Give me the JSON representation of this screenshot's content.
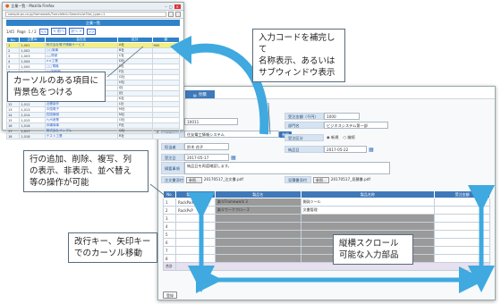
{
  "colors": {
    "accent": "#2f82c8",
    "arrow": "#3fa9e0",
    "highlight": "#f4f07a"
  },
  "popup": {
    "title": "企業一覧 - Mozilla Firefox",
    "url": "sample.ps.co.jp/framework/?servletid=SearchList?list_type=1",
    "header": "企業一覧",
    "pager": {
      "count": "1/45",
      "page_label": "Page",
      "page": "1 / 2",
      "prev": "< 前へ",
      "next": "次へ >",
      "first": "<<",
      "last": ">>"
    },
    "columns": [
      "No.",
      "企業ID",
      "会社名",
      "区分",
      "値"
    ],
    "rows": [
      {
        "no": "1",
        "id": "1,001",
        "name": "株式会社電子情報サービス",
        "kbn": "A社",
        "val": "900"
      },
      {
        "no": "2",
        "id": "1,002",
        "name": "○○商事",
        "kbn": "B社",
        "val": ""
      },
      {
        "no": "3",
        "id": "1,003",
        "name": "△△物産",
        "kbn": "C社",
        "val": ""
      },
      {
        "no": "4",
        "id": "1,004",
        "name": "××工業",
        "kbn": "D社",
        "val": ""
      },
      {
        "no": "5",
        "id": "1,005",
        "name": "□□電機",
        "kbn": "E社",
        "val": ""
      },
      {
        "no": "6",
        "id": "1,006",
        "name": "◇◇製作所",
        "kbn": "F社",
        "val": ""
      },
      {
        "no": "7",
        "id": "1,007",
        "name": "☆☆システム",
        "kbn": "G社",
        "val": ""
      },
      {
        "no": "8",
        "id": "1,008",
        "name": "北海道物流",
        "kbn": "H社",
        "val": ""
      },
      {
        "no": "9",
        "id": "1,009",
        "name": "東北開発",
        "kbn": "I社",
        "val": ""
      },
      {
        "no": "10",
        "id": "1,010",
        "name": "関東商会",
        "kbn": "J社",
        "val": ""
      },
      {
        "no": "11",
        "id": "1,011",
        "name": "中部工業",
        "kbn": "K社",
        "val": ""
      },
      {
        "no": "12",
        "id": "1,012",
        "name": "近畿製作",
        "kbn": "L社",
        "val": ""
      },
      {
        "no": "13",
        "id": "1,013",
        "name": "中国電子",
        "kbn": "M社",
        "val": ""
      },
      {
        "no": "14",
        "id": "1,014",
        "name": "四国機械",
        "kbn": "N社",
        "val": ""
      },
      {
        "no": "15",
        "id": "1,015",
        "name": "九州産業",
        "kbn": "O社",
        "val": ""
      },
      {
        "no": "16",
        "id": "1,016",
        "name": "沖縄商事",
        "kbn": "P社",
        "val": ""
      },
      {
        "no": "17",
        "id": "1,017",
        "name": "株式会社サンプル",
        "kbn": "Q社",
        "val": ""
      },
      {
        "no": "18",
        "id": "1,018",
        "name": "テスト工業",
        "kbn": "R社",
        "val": ""
      }
    ]
  },
  "form": {
    "tab": "見積",
    "order_no_label": "受注番号",
    "order_no": "10011",
    "customer_label": "顧客名",
    "customer": "住友電工情報システム",
    "customer_btn": "参照",
    "person_label": "担当者",
    "person": "鈴木 花子",
    "date_label": "受注日",
    "date": "2017-05-17",
    "sales_label": "受注金額（千円）",
    "sales": "1000",
    "dept_label": "部門名",
    "dept": "ビジネスシステム第一部",
    "class_label": "受注区分",
    "class_opt1": "新規",
    "class_opt2": "継続",
    "ship_label": "納品日",
    "ship": "2017-05-22",
    "remarks_label": "摘要事項",
    "remarks": "納品日を再度確認します。",
    "file1_label": "注文書添付",
    "file1_btn": "参照...",
    "file1": "20170517_注文書.pdf",
    "file2_label": "見積書添付",
    "file2_btn": "参照...",
    "file2": "20170517_見積書.pdf",
    "grid_cols": [
      "No.",
      "製品コード",
      "製品名",
      "製品名称",
      "受注金額"
    ],
    "grid_rows": [
      {
        "no": "1",
        "code": "RackPad",
        "name": "楽々Framework 3",
        "label": "開発ツール"
      },
      {
        "no": "2",
        "code": "RackPvP",
        "name": "楽々ワークフロー 2",
        "label": "文書管理"
      },
      {
        "no": "3",
        "code": "",
        "name": "",
        "label": ""
      },
      {
        "no": "4",
        "code": "",
        "name": "",
        "label": ""
      },
      {
        "no": "5",
        "code": "",
        "name": "",
        "label": ""
      },
      {
        "no": "6",
        "code": "",
        "name": "",
        "label": ""
      },
      {
        "no": "7",
        "code": "",
        "name": "",
        "label": ""
      },
      {
        "no": "8",
        "code": "",
        "name": "",
        "label": ""
      }
    ],
    "footer_no": "合計",
    "register_btn": "登録"
  },
  "callouts": {
    "c1": "カーソルのある項目に\n背景色をつける",
    "c2": "入力コードを補完して\n名称表示、あるいは\nサブウィンドウ表示",
    "c3": "行の追加、削除、複写、列\nの表示、非表示、並べ替え\n等の操作が可能",
    "c4": "改行キー、矢印キー\nでのカーソル移動",
    "c5": "縦横スクロール\n可能な入力部品"
  }
}
